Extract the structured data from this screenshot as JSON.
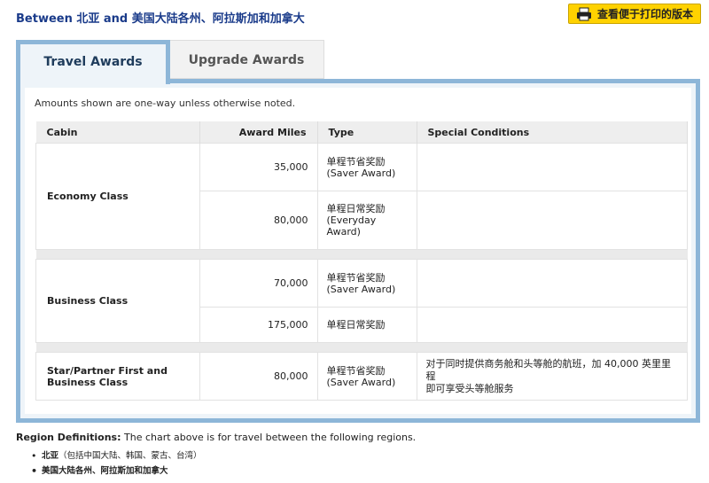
{
  "heading": "Between 北亚 and 美国大陆各州、阿拉斯加和加拿大",
  "print_button": {
    "label": "查看便于打印的版本",
    "icon": "printer-icon"
  },
  "tabs": [
    {
      "label": "Travel Awards",
      "active": true
    },
    {
      "label": "Upgrade Awards",
      "active": false
    }
  ],
  "note": "Amounts shown are one-way unless otherwise noted.",
  "table": {
    "headers": {
      "cabin": "Cabin",
      "miles": "Award Miles",
      "type": "Type",
      "cond": "Special Conditions"
    },
    "groups": [
      {
        "cabin": "Economy Class",
        "rows": [
          {
            "miles": "35,000",
            "type": "单程节省奖励\n(Saver Award)",
            "cond": ""
          },
          {
            "miles": "80,000",
            "type": "单程日常奖励\n(Everyday\nAward)",
            "cond": ""
          }
        ]
      },
      {
        "cabin": "Business Class",
        "rows": [
          {
            "miles": "70,000",
            "type": "单程节省奖励\n(Saver Award)",
            "cond": ""
          },
          {
            "miles": "175,000",
            "type": "单程日常奖励",
            "cond": ""
          }
        ]
      },
      {
        "cabin": "Star/Partner First and\nBusiness Class",
        "rows": [
          {
            "miles": "80,000",
            "type": "单程节省奖励\n(Saver Award)",
            "cond": "对于同时提供商务舱和头等舱的航班，加 40,000 英里里程\n即可享受头等舱服务"
          }
        ]
      }
    ]
  },
  "region": {
    "label": "Region Definitions:",
    "text": " The chart above is for travel between the following regions.",
    "items": [
      {
        "name": "北亚",
        "detail": "（包括中国大陆、韩国、蒙古、台湾）"
      },
      {
        "name": "美国大陆各州、阿拉斯加和加拿大",
        "detail": ""
      }
    ]
  },
  "colors": {
    "heading": "#1a3b8a",
    "tab_border": "#8db6d8",
    "print_bg": "#ffd200"
  }
}
